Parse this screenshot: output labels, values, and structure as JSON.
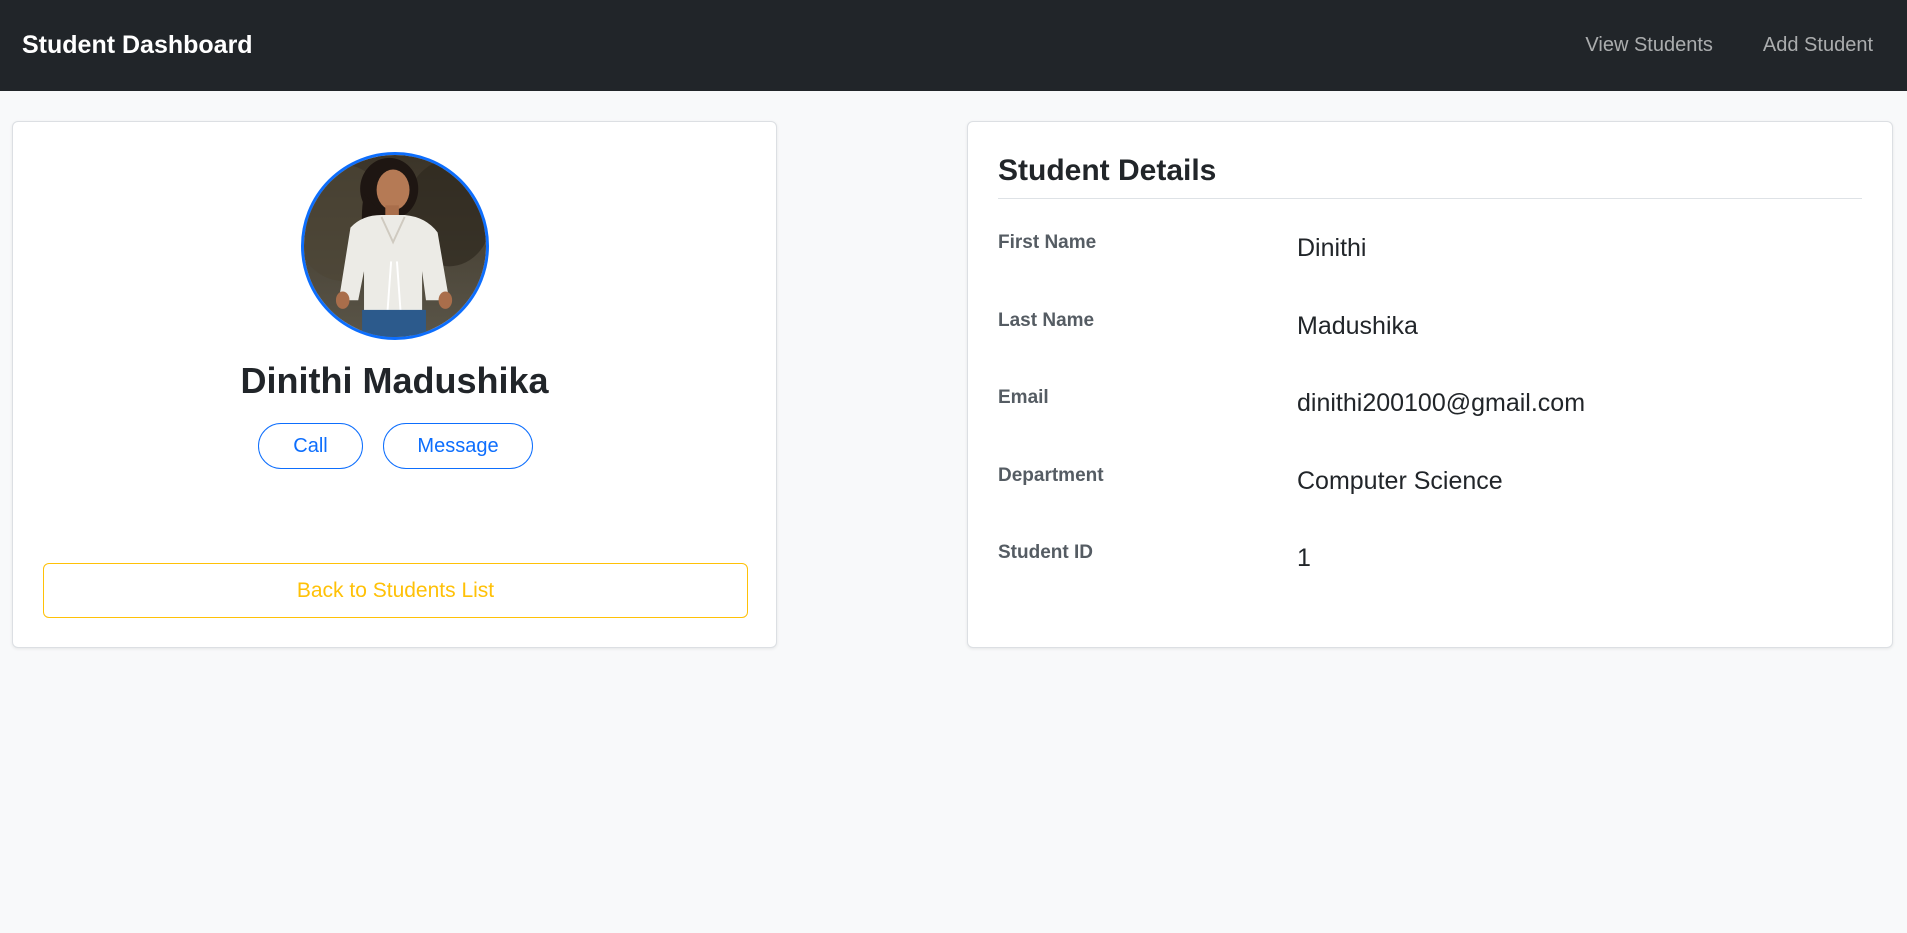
{
  "navbar": {
    "brand": "Student Dashboard",
    "links": [
      {
        "label": "View Students"
      },
      {
        "label": "Add Student"
      }
    ]
  },
  "profile": {
    "name": "Dinithi Madushika",
    "call_label": "Call",
    "message_label": "Message",
    "back_label": "Back to Students List"
  },
  "details": {
    "title": "Student Details",
    "rows": [
      {
        "label": "First Name",
        "value": "Dinithi"
      },
      {
        "label": "Last Name",
        "value": "Madushika"
      },
      {
        "label": "Email",
        "value": "dinithi200100@gmail.com"
      },
      {
        "label": "Department",
        "value": "Computer Science"
      },
      {
        "label": "Student ID",
        "value": "1"
      }
    ]
  },
  "colors": {
    "navbar_bg": "#212529",
    "primary": "#0d6efd",
    "warning": "#ffc107",
    "page_bg": "#f8f9fa"
  }
}
